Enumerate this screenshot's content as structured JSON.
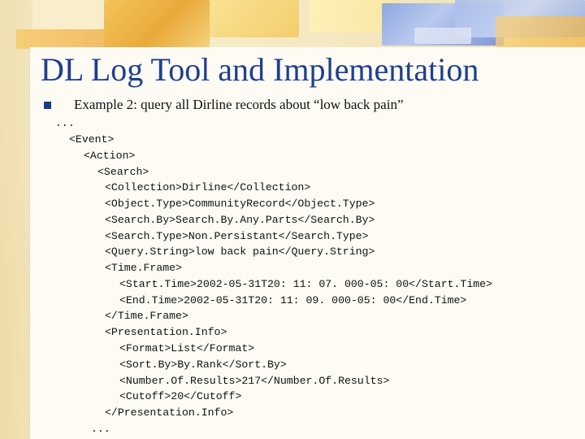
{
  "slide": {
    "title": "DL Log Tool and Implementation",
    "bullet": "Example 2: query all Dirline records about “low back pain”",
    "code_lines": [
      "...",
      "<Event>",
      "<Action>",
      "<Search>",
      "<Collection>Dirline</Collection>",
      "<Object.Type>CommunityRecord</Object.Type>",
      "<Search.By>Search.By.Any.Parts</Search.By>",
      "<Search.Type>Non.Persistant</Search.Type>",
      "<Query.String>low back pain</Query.String>",
      "<Time.Frame>",
      "<Start.Time>2002-05-31T20: 11: 07. 000-05: 00</Start.Time>",
      "<End.Time>2002-05-31T20: 11: 09. 000-05: 00</End.Time>",
      "</Time.Frame>",
      "<Presentation.Info>",
      "<Format>List</Format>",
      "<Sort.By>By.Rank</Sort.By>",
      "<Number.Of.Results>217</Number.Of.Results>",
      "<Cutoff>20</Cutoff>",
      "</Presentation.Info>",
      "..."
    ]
  }
}
